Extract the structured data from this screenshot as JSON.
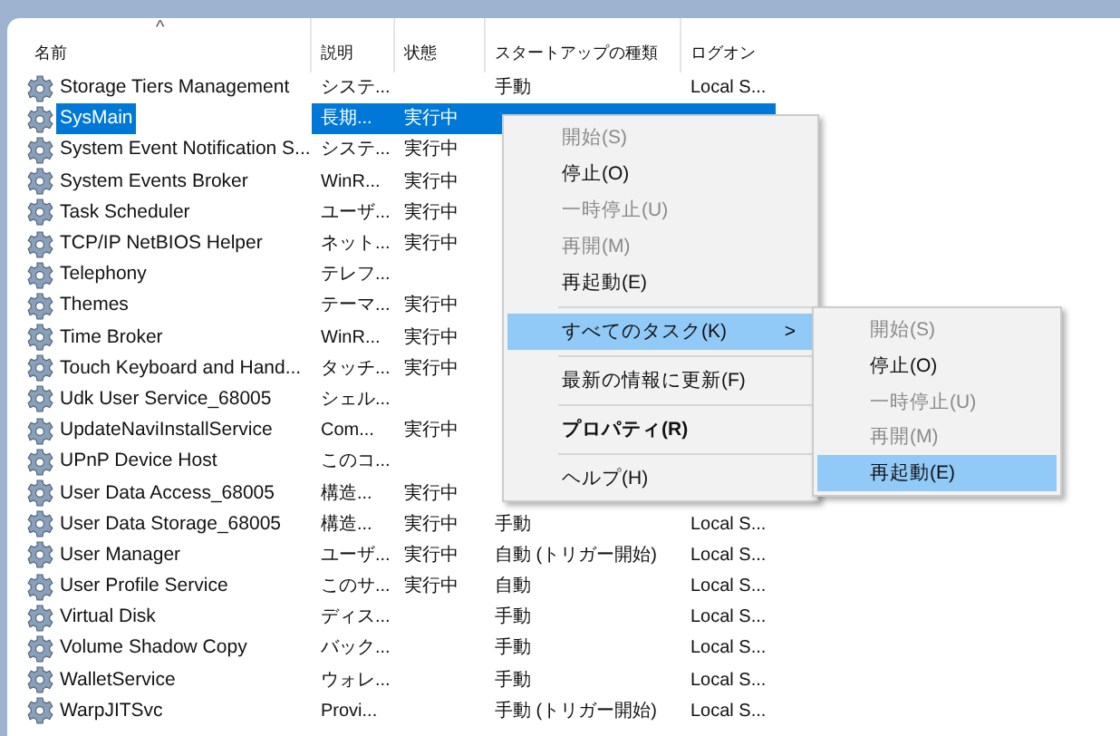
{
  "table": {
    "columns": [
      {
        "label": "名前",
        "sort_indicator": "^"
      },
      {
        "label": "説明"
      },
      {
        "label": "状態"
      },
      {
        "label": "スタートアップの種類"
      },
      {
        "label": "ログオン"
      }
    ],
    "rows": [
      {
        "name": "Storage Tiers Management",
        "description": "システ...",
        "status": "",
        "startup": "手動",
        "logon": "Local S...",
        "selected": false
      },
      {
        "name": "SysMain",
        "description": "長期...",
        "status": "実行中",
        "selected": true
      },
      {
        "name": "System Event Notification S...",
        "description": "システ...",
        "status": "実行中",
        "selected": false
      },
      {
        "name": "System Events Broker",
        "description": "WinR...",
        "status": "実行中",
        "selected": false
      },
      {
        "name": "Task Scheduler",
        "description": "ユーザ...",
        "status": "実行中",
        "selected": false
      },
      {
        "name": "TCP/IP NetBIOS Helper",
        "description": "ネット...",
        "status": "実行中",
        "selected": false
      },
      {
        "name": "Telephony",
        "description": "テレフ...",
        "status": "",
        "selected": false
      },
      {
        "name": "Themes",
        "description": "テーマ...",
        "status": "実行中",
        "selected": false
      },
      {
        "name": "Time Broker",
        "description": "WinR...",
        "status": "実行中",
        "selected": false
      },
      {
        "name": "Touch Keyboard and Hand...",
        "description": "タッチ...",
        "status": "実行中",
        "selected": false
      },
      {
        "name": "Udk User Service_68005",
        "description": "シェル...",
        "status": "",
        "selected": false
      },
      {
        "name": "UpdateNaviInstallService",
        "description": "Com...",
        "status": "実行中",
        "selected": false
      },
      {
        "name": "UPnP Device Host",
        "description": "このコ...",
        "status": "",
        "selected": false
      },
      {
        "name": "User Data Access_68005",
        "description": "構造...",
        "status": "実行中",
        "selected": false
      },
      {
        "name": "User Data Storage_68005",
        "description": "構造...",
        "status": "実行中",
        "startup": "手動",
        "logon": "Local S...",
        "selected": false
      },
      {
        "name": "User Manager",
        "description": "ユーザ...",
        "status": "実行中",
        "startup": "自動 (トリガー開始)",
        "logon": "Local S...",
        "selected": false
      },
      {
        "name": "User Profile Service",
        "description": "このサ...",
        "status": "実行中",
        "startup": "自動",
        "logon": "Local S...",
        "selected": false
      },
      {
        "name": "Virtual Disk",
        "description": "ディス...",
        "status": "",
        "startup": "手動",
        "logon": "Local S...",
        "selected": false
      },
      {
        "name": "Volume Shadow Copy",
        "description": "バック...",
        "status": "",
        "startup": "手動",
        "logon": "Local S...",
        "selected": false
      },
      {
        "name": "WalletService",
        "description": "ウォレ...",
        "status": "",
        "startup": "手動",
        "logon": "Local S...",
        "selected": false
      },
      {
        "name": "WarpJITSvc",
        "description": "Provi...",
        "status": "",
        "startup": "手動 (トリガー開始)",
        "logon": "Local S...",
        "selected": false
      }
    ]
  },
  "context_menu": {
    "items": [
      {
        "kind": "item",
        "label": "開始(S)",
        "disabled": true,
        "bold": false,
        "selected": false
      },
      {
        "kind": "item",
        "label": "停止(O)",
        "disabled": false,
        "bold": false,
        "selected": false
      },
      {
        "kind": "item",
        "label": "一時停止(U)",
        "disabled": true,
        "bold": false,
        "selected": false
      },
      {
        "kind": "item",
        "label": "再開(M)",
        "disabled": true,
        "bold": false,
        "selected": false
      },
      {
        "kind": "item",
        "label": "再起動(E)",
        "disabled": false,
        "bold": false,
        "selected": false
      },
      {
        "kind": "separator"
      },
      {
        "kind": "submenu",
        "label": "すべてのタスク(K)",
        "arrow": ">",
        "disabled": false,
        "bold": false,
        "selected": true
      },
      {
        "kind": "separator"
      },
      {
        "kind": "item",
        "label": "最新の情報に更新(F)",
        "disabled": false,
        "bold": false,
        "selected": false
      },
      {
        "kind": "separator"
      },
      {
        "kind": "item",
        "label": "プロパティ(R)",
        "disabled": false,
        "bold": true,
        "selected": false
      },
      {
        "kind": "separator"
      },
      {
        "kind": "item",
        "label": "ヘルプ(H)",
        "disabled": false,
        "bold": false,
        "selected": false
      }
    ]
  },
  "submenu": {
    "items": [
      {
        "label": "開始(S)",
        "disabled": true,
        "selected": false
      },
      {
        "label": "停止(O)",
        "disabled": false,
        "selected": false
      },
      {
        "label": "一時停止(U)",
        "disabled": true,
        "selected": false
      },
      {
        "label": "再開(M)",
        "disabled": true,
        "selected": false
      },
      {
        "label": "再起動(E)",
        "disabled": false,
        "selected": true
      }
    ]
  }
}
